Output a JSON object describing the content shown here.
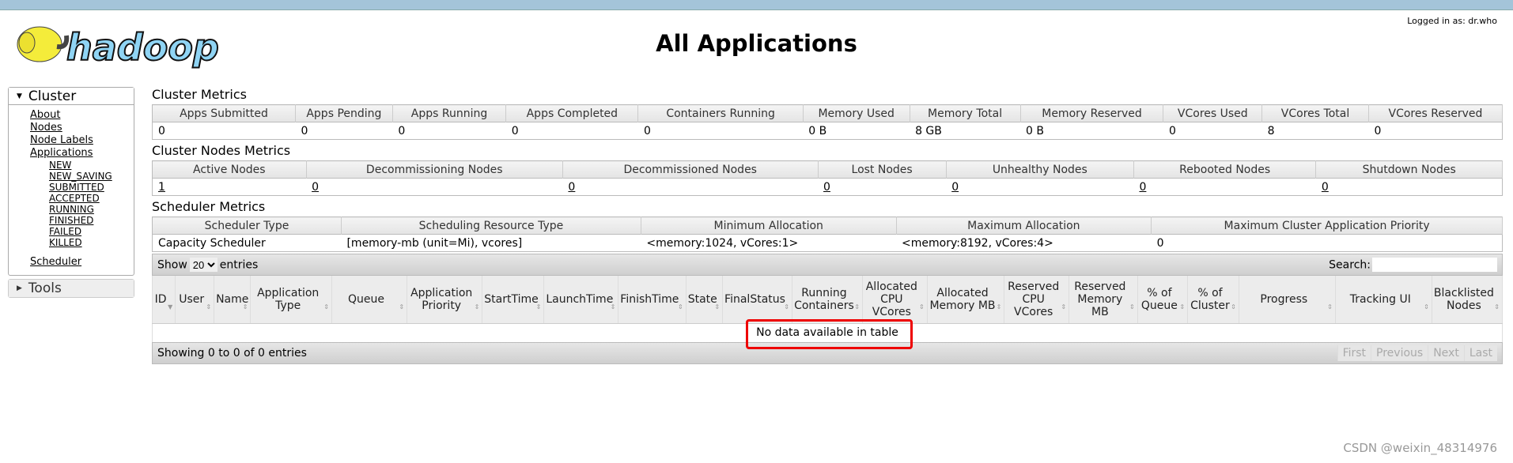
{
  "header": {
    "logged_in": "Logged in as: dr.who",
    "title": "All Applications",
    "logo_text": "hadoop"
  },
  "sidebar": {
    "cluster": {
      "label": "Cluster",
      "items": [
        {
          "label": "About"
        },
        {
          "label": "Nodes"
        },
        {
          "label": "Node Labels"
        },
        {
          "label": "Applications"
        }
      ],
      "states": [
        "NEW",
        "NEW_SAVING",
        "SUBMITTED",
        "ACCEPTED",
        "RUNNING",
        "FINISHED",
        "FAILED",
        "KILLED"
      ],
      "scheduler": "Scheduler"
    },
    "tools": {
      "label": "Tools"
    }
  },
  "cluster_metrics": {
    "title": "Cluster Metrics",
    "headers": [
      "Apps Submitted",
      "Apps Pending",
      "Apps Running",
      "Apps Completed",
      "Containers Running",
      "Memory Used",
      "Memory Total",
      "Memory Reserved",
      "VCores Used",
      "VCores Total",
      "VCores Reserved"
    ],
    "values": [
      "0",
      "0",
      "0",
      "0",
      "0",
      "0 B",
      "8 GB",
      "0 B",
      "0",
      "8",
      "0"
    ]
  },
  "node_metrics": {
    "title": "Cluster Nodes Metrics",
    "headers": [
      "Active Nodes",
      "Decommissioning Nodes",
      "Decommissioned Nodes",
      "Lost Nodes",
      "Unhealthy Nodes",
      "Rebooted Nodes",
      "Shutdown Nodes"
    ],
    "values": [
      "1",
      "0",
      "0",
      "0",
      "0",
      "0",
      "0"
    ]
  },
  "scheduler_metrics": {
    "title": "Scheduler Metrics",
    "headers": [
      "Scheduler Type",
      "Scheduling Resource Type",
      "Minimum Allocation",
      "Maximum Allocation",
      "Maximum Cluster Application Priority"
    ],
    "values": [
      "Capacity Scheduler",
      "[memory-mb (unit=Mi), vcores]",
      "<memory:1024, vCores:1>",
      "<memory:8192, vCores:4>",
      "0"
    ]
  },
  "apps": {
    "show": "Show",
    "page_size": "20",
    "entries": "entries",
    "search_label": "Search:",
    "search_value": "",
    "columns": [
      "ID",
      "User",
      "Name",
      "Application Type",
      "Queue",
      "Application Priority",
      "StartTime",
      "LaunchTime",
      "FinishTime",
      "State",
      "FinalStatus",
      "Running Containers",
      "Allocated CPU VCores",
      "Allocated Memory MB",
      "Reserved CPU VCores",
      "Reserved Memory MB",
      "% of Queue",
      "% of Cluster",
      "Progress",
      "Tracking UI",
      "Blacklisted Nodes"
    ],
    "empty": "No data available in table",
    "info": "Showing 0 to 0 of 0 entries",
    "pager": [
      "First",
      "Previous",
      "Next",
      "Last"
    ]
  },
  "watermark": "CSDN @weixin_48314976",
  "colors": {
    "topbar": "#a4c4d9",
    "highlight": "#e00000"
  }
}
